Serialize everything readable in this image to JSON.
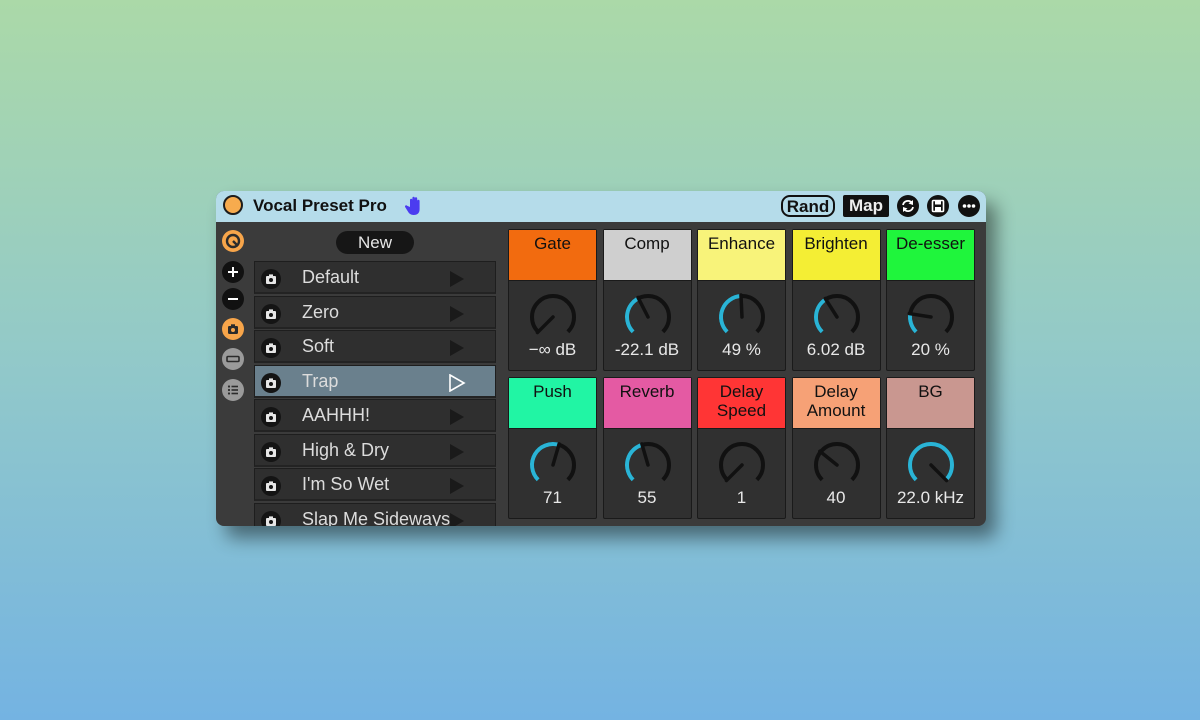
{
  "device": {
    "title": "Vocal Preset Pro",
    "rand_label": "Rand",
    "map_label": "Map",
    "new_label": "New"
  },
  "presets": [
    {
      "label": "Default",
      "selected": false
    },
    {
      "label": "Zero",
      "selected": false
    },
    {
      "label": "Soft",
      "selected": false
    },
    {
      "label": "Trap",
      "selected": true
    },
    {
      "label": "AAHHH!",
      "selected": false
    },
    {
      "label": "High & Dry",
      "selected": false
    },
    {
      "label": "I'm So Wet",
      "selected": false
    },
    {
      "label": "Slap Me Sideways",
      "selected": false
    }
  ],
  "modules": [
    {
      "label": "Gate",
      "value": "−∞ dB",
      "color": "#f26b0f",
      "knob_fraction": 0.0,
      "arc": false
    },
    {
      "label": "Comp",
      "value": "-22.1 dB",
      "color": "#cfcfcf",
      "knob_fraction": 0.4,
      "arc": true
    },
    {
      "label": "Enhance",
      "value": "49 %",
      "color": "#f8f37a",
      "knob_fraction": 0.49,
      "arc": true
    },
    {
      "label": "Brighten",
      "value": "6.02 dB",
      "color": "#f4ee34",
      "knob_fraction": 0.38,
      "arc": true
    },
    {
      "label": "De-esser",
      "value": "20 %",
      "color": "#1ff53c",
      "knob_fraction": 0.2,
      "arc": true
    },
    {
      "label": "Push",
      "value": "71",
      "color": "#21f5a4",
      "knob_fraction": 0.56,
      "arc": true
    },
    {
      "label": "Reverb",
      "value": "55",
      "color": "#e45aa3",
      "knob_fraction": 0.44,
      "arc": true
    },
    {
      "label": "Delay\nSpeed",
      "value": "1",
      "color": "#ff3535",
      "knob_fraction": 0.0,
      "arc": false
    },
    {
      "label": "Delay\nAmount",
      "value": "40",
      "color": "#f6a176",
      "knob_fraction": 0.31,
      "arc": false
    },
    {
      "label": "BG",
      "value": "22.0 kHz",
      "color": "#c99790",
      "knob_fraction": 1.0,
      "arc": true
    }
  ],
  "colors": {
    "accent_knob": "#2ab4d6",
    "power": "#f7ab4e",
    "titlebar": "#b5dcea",
    "selected_row": "#6a808d"
  },
  "icons": {
    "hand": "hand-icon",
    "sync": "sync-icon",
    "save": "save-icon",
    "more": "more-icon",
    "preset": "camera-icon",
    "play": "play-icon"
  }
}
